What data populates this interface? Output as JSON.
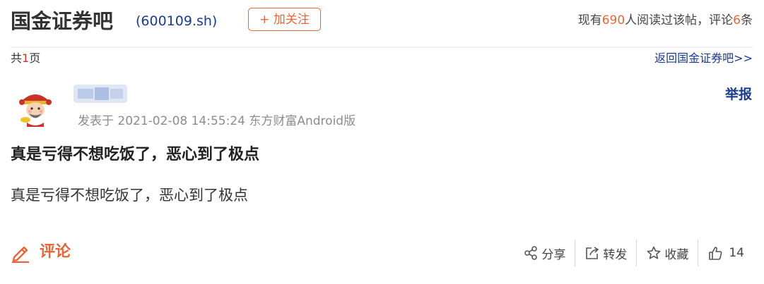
{
  "header": {
    "bar_name": "国金证券吧",
    "stock_code": "(600109.sh)",
    "follow_button": "+ 加关注",
    "read_prefix": "现有",
    "read_count": "690",
    "read_mid": "人阅读过该帖，评论",
    "comment_count": "6",
    "read_suffix": "条"
  },
  "pagination": {
    "prefix": "共",
    "pages": "1",
    "suffix": "页",
    "back_link": "返回国金证券吧>>"
  },
  "post": {
    "report_label": "举报",
    "meta": "发表于 2021-02-08 14:55:24 东方财富Android版",
    "title": "真是亏得不想吃饭了，恶心到了极点",
    "body": "真是亏得不想吃饭了，恶心到了极点"
  },
  "actions": {
    "comment_label": "评论",
    "share_label": "分享",
    "repost_label": "转发",
    "collect_label": "收藏",
    "like_count": "14"
  },
  "colors": {
    "accent_orange": "#e2673b",
    "link_blue": "#1a3c8a",
    "count_red": "#d9331f",
    "meta_gray": "#8c8c8c"
  },
  "icons": [
    "avatar",
    "pencil-icon",
    "share-icon",
    "repost-icon",
    "star-icon",
    "thumbs-up-icon"
  ]
}
